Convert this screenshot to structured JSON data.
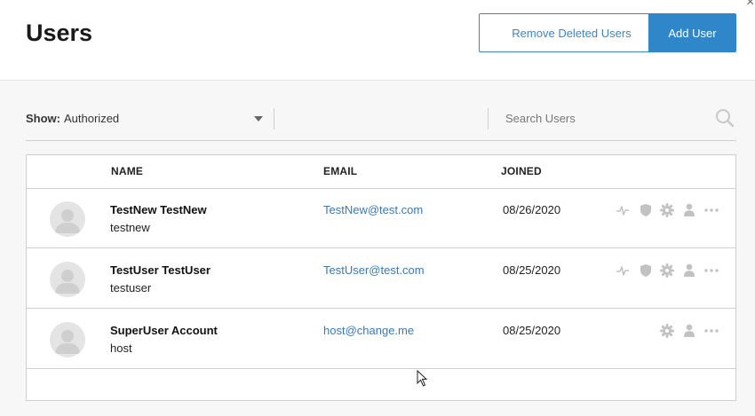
{
  "header": {
    "title": "Users",
    "remove_deleted_label": "Remove Deleted Users",
    "add_user_label": "Add User",
    "close_glyph": "×"
  },
  "filter": {
    "show_label": "Show:",
    "show_value": "Authorized",
    "search_placeholder": "Search Users"
  },
  "table": {
    "headers": {
      "name": "NAME",
      "email": "EMAIL",
      "joined": "JOINED"
    },
    "rows": [
      {
        "display_name": "TestNew TestNew",
        "username": "testnew",
        "email": "TestNew@test.com",
        "joined": "08/26/2020",
        "actions": [
          "activity-icon",
          "shield-icon",
          "gear-icon",
          "person-icon",
          "more-icon"
        ]
      },
      {
        "display_name": "TestUser TestUser",
        "username": "testuser",
        "email": "TestUser@test.com",
        "joined": "08/25/2020",
        "actions": [
          "activity-icon",
          "shield-icon",
          "gear-icon",
          "person-icon",
          "more-icon"
        ]
      },
      {
        "display_name": "SuperUser Account",
        "username": "host",
        "email": "host@change.me",
        "joined": "08/25/2020",
        "actions": [
          "gear-icon",
          "person-icon",
          "more-icon"
        ]
      }
    ]
  },
  "colors": {
    "accent": "#2f86c9",
    "link": "#3a78b5",
    "icon_gray": "#c2c2c2"
  }
}
